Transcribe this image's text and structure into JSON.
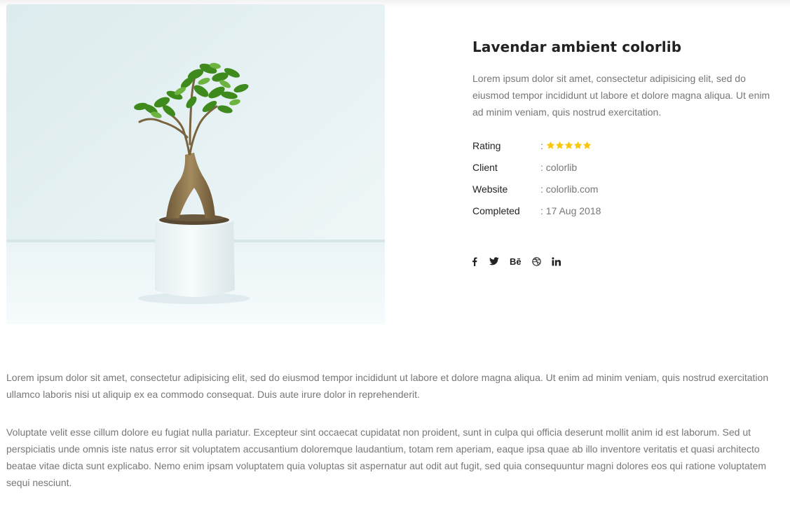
{
  "project": {
    "title": "Lavendar ambient colorlib",
    "description": "Lorem ipsum dolor sit amet, consectetur adipisicing elit, sed do eiusmod tempor incididunt ut labore et dolore magna aliqua. Ut enim ad minim veniam, quis nostrud exercitation.",
    "rating": {
      "label": "Rating",
      "separator": ":",
      "value": 5,
      "max": 5,
      "star_color": "#f9c80e"
    },
    "client": {
      "label": "Client",
      "value": ": colorlib"
    },
    "website": {
      "label": "Website",
      "value": ": colorlib.com"
    },
    "completed": {
      "label": "Completed",
      "value": ": 17 Aug 2018"
    }
  },
  "social": [
    {
      "icon": "facebook-icon"
    },
    {
      "icon": "twitter-icon"
    },
    {
      "icon": "behance-icon",
      "text": "Bē"
    },
    {
      "icon": "dribbble-icon"
    },
    {
      "icon": "linkedin-icon"
    }
  ],
  "body": {
    "paragraph_1": "Lorem ipsum dolor sit amet, consectetur adipisicing elit, sed do eiusmod tempor incididunt ut labore et dolore magna aliqua. Ut enim ad minim veniam, quis nostrud exercitation ullamco laboris nisi ut aliquip ex ea commodo consequat. Duis aute irure dolor in reprehenderit.",
    "paragraph_2": "Voluptate velit esse cillum dolore eu fugiat nulla pariatur. Excepteur sint occaecat cupidatat non proident, sunt in culpa qui officia deserunt mollit anim id est laborum. Sed ut perspiciatis unde omnis iste natus error sit voluptatem accusantium doloremque laudantium, totam rem aperiam, eaque ipsa quae ab illo inventore veritatis et quasi architecto beatae vitae dicta sunt explicabo. Nemo enim ipsam voluptatem quia voluptas sit aspernatur aut odit aut fugit, sed quia consequuntur magni dolores eos qui ratione voluptatem sequi nesciunt."
  },
  "colors": {
    "heading": "#222222",
    "text": "#777777",
    "star": "#f9c80e"
  }
}
